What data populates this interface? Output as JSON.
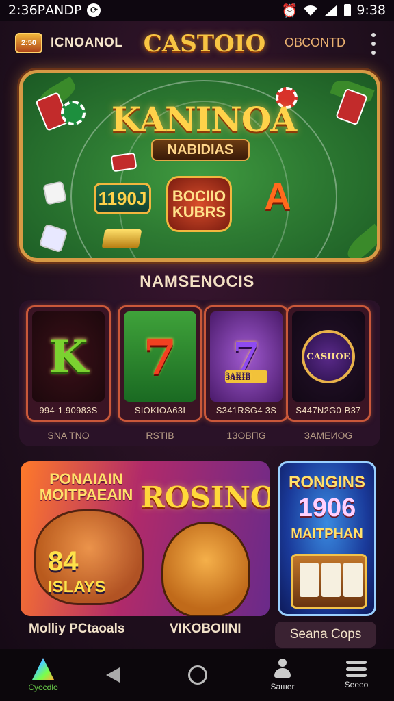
{
  "status_bar": {
    "left_text": "2:36РАNDP",
    "time": "9:38",
    "signal_label": "4⁄"
  },
  "header": {
    "brand_badge": "2:50",
    "brand_name": "ICNOANOL",
    "logo_text": "CASTOIO",
    "account_text": "ОВСОNTD"
  },
  "banner": {
    "title": "KANINOA",
    "subtitle": "NABIDIAS",
    "tile_number": "1190J",
    "tile_text": "BOCIIO\nKUBRS",
    "tile_letter": "A"
  },
  "section": {
    "title": "NAMSENOCIS"
  },
  "games": [
    {
      "art": "K",
      "code": "994-1.90983S",
      "label": "SNA TNO"
    },
    {
      "art": "7",
      "code": "SIOKIOA63I",
      "label": "RSTIB"
    },
    {
      "art": "7",
      "sub": "ЗАКІВ",
      "code": "S341RSG4 3S",
      "label": "1ЗОВПG"
    },
    {
      "art": "CASIIOE",
      "code": "S447N2G0-B37",
      "label": "ЗАМЕИОG"
    }
  ],
  "promos": [
    {
      "line1": "PONAIAIN\nMOITPAEAIN",
      "line2": "ROSINO",
      "line3": "84",
      "line4": "ISLAYS",
      "label": "Molliy PCtaoals",
      "label2": "VIKOBOIINI"
    },
    {
      "line1": "RONGINS",
      "line2": "1906",
      "line3": "MAITPHAN",
      "label": "Seana Cops"
    }
  ],
  "navbar": {
    "items": [
      {
        "label": "Суocdlo",
        "icon": "triangle-icon"
      },
      {
        "label": "",
        "icon": "back-icon"
      },
      {
        "label": "",
        "icon": "home-icon"
      },
      {
        "label": "Saшer",
        "icon": "person-icon"
      },
      {
        "label": "Seeeo",
        "icon": "menu-icon"
      }
    ]
  },
  "colors": {
    "gold": "#f7c543",
    "frame": "#d79a45",
    "felt": "#2d7a32",
    "background": "#1c0c1e"
  }
}
